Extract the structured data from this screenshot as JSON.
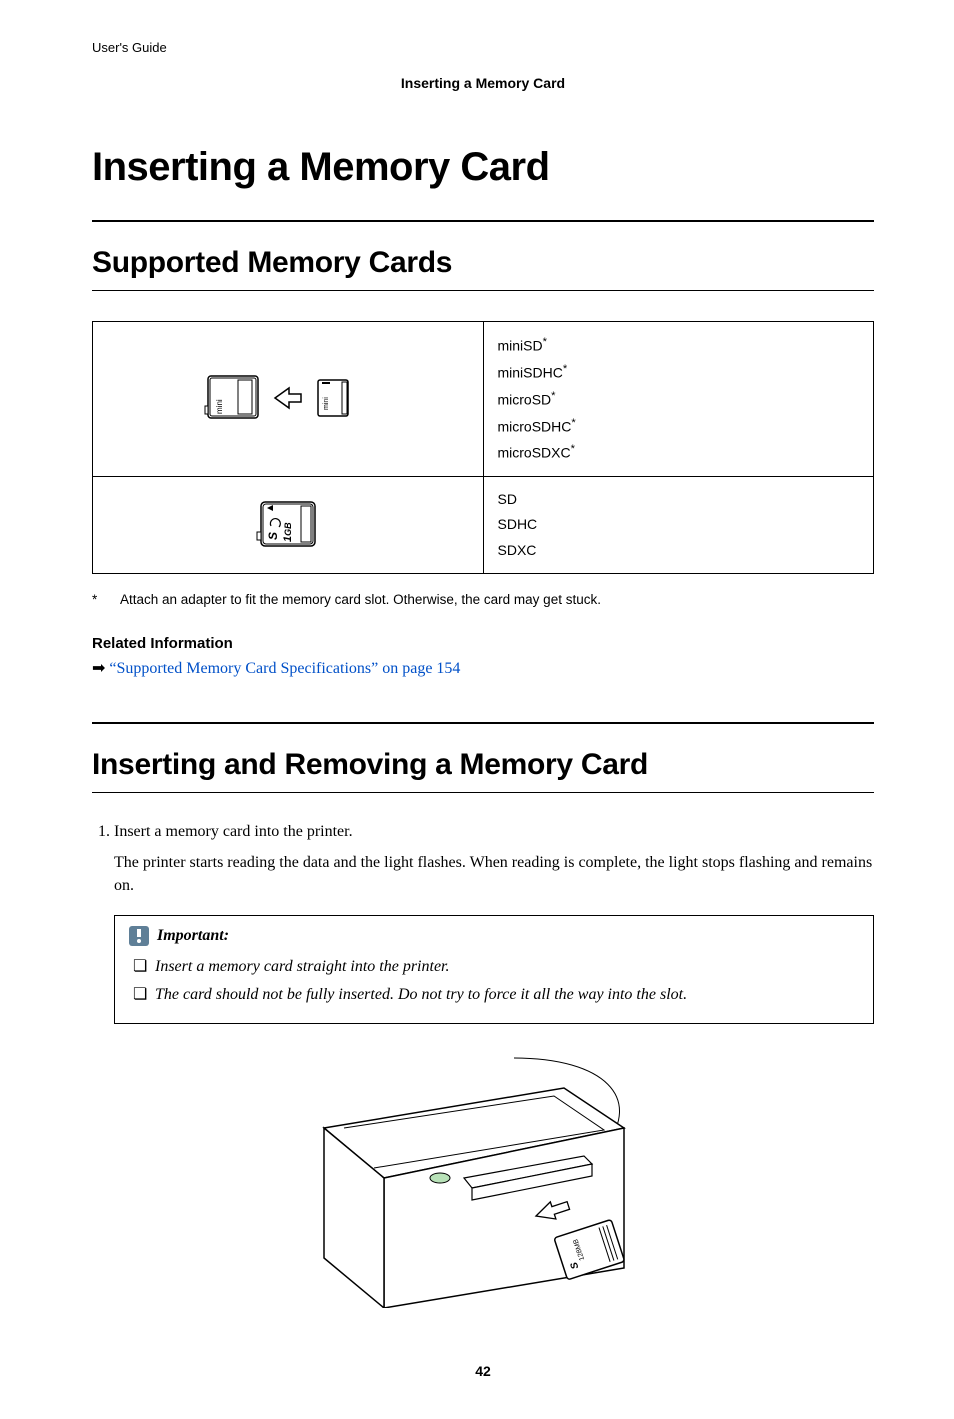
{
  "header": {
    "guide": "User's Guide"
  },
  "breadcrumb": "Inserting a Memory Card",
  "title": "Inserting a Memory Card",
  "sections": {
    "supported": {
      "heading": "Supported Memory Cards",
      "rows": [
        {
          "items": [
            "miniSD*",
            "miniSDHC*",
            "microSD*",
            "microSDHC*",
            "microSDXC*"
          ]
        },
        {
          "items": [
            "SD",
            "SDHC",
            "SDXC"
          ]
        }
      ],
      "footnote_marker": "*",
      "footnote": "Attach an adapter to fit the memory card slot. Otherwise, the card may get stuck.",
      "related_heading": "Related Information",
      "related_link_text": "“Supported Memory Card Specifications” on page 154"
    },
    "inserting": {
      "heading": "Inserting and Removing a Memory Card",
      "step1": "Insert a memory card into the printer.",
      "step1_desc": "The printer starts reading the data and the light flashes. When reading is complete, the light stops flashing and remains on.",
      "important_label": "Important:",
      "important_items": [
        "Insert a memory card straight into the printer.",
        "The card should not be fully inserted. Do not try to force it all the way into the slot."
      ]
    }
  },
  "icons": {
    "sd_full_label_top": "1",
    "sd_full_label_bottom": "GB",
    "mini_label": "mini"
  },
  "pagenum": "42"
}
